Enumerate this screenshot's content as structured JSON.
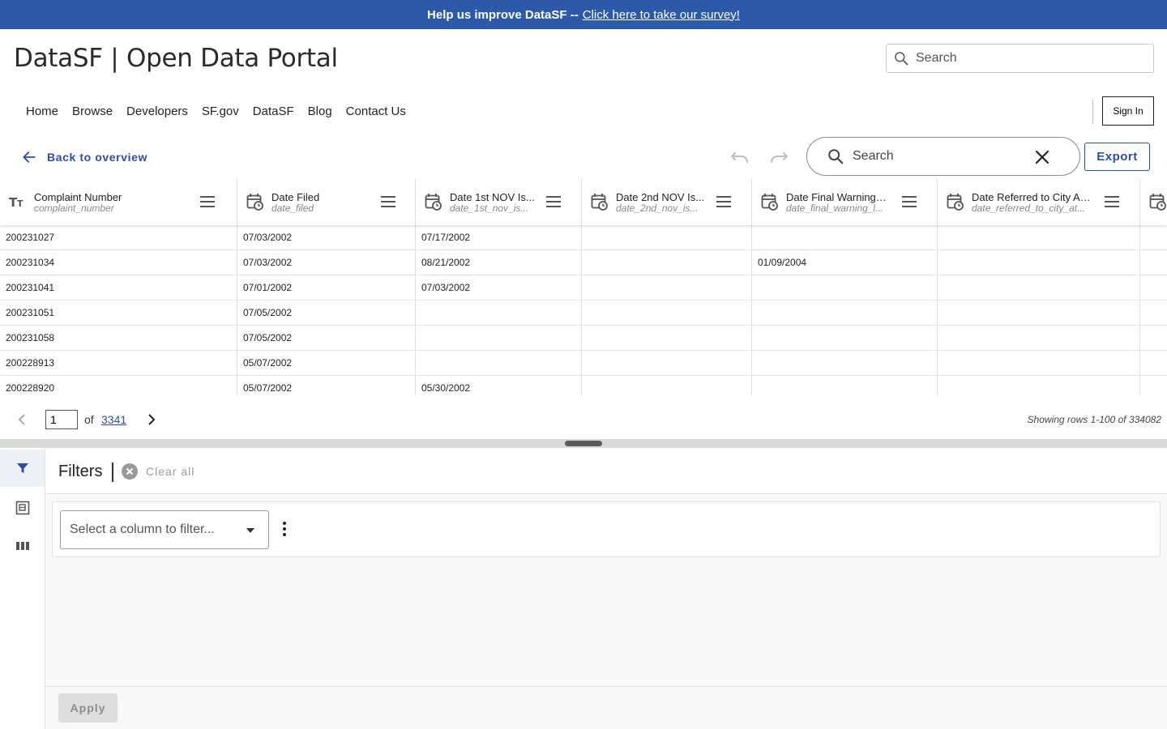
{
  "banner": {
    "text": "Help us improve DataSF --",
    "link_text": "Click here to take our survey!",
    "bg_color": "#2c5aa8"
  },
  "site": {
    "title": "DataSF | Open Data Portal",
    "search_placeholder": "Search"
  },
  "nav": {
    "items": [
      "Home",
      "Browse",
      "Developers",
      "SF.gov",
      "DataSF",
      "Blog",
      "Contact Us"
    ],
    "sign_in": "Sign In"
  },
  "toolbar": {
    "back_label": "Back to overview",
    "search_placeholder": "Search",
    "export_label": "Export",
    "accent_color": "#2c4fa3"
  },
  "grid": {
    "columns": [
      {
        "name": "Complaint Number",
        "field": "complaint_number",
        "type_icon": "text-type-icon"
      },
      {
        "name": "Date Filed",
        "field": "date_filed",
        "type_icon": "calendar-date-icon"
      },
      {
        "name": "Date 1st NOV Is...",
        "field": "date_1st_nov_is...",
        "type_icon": "calendar-date-icon"
      },
      {
        "name": "Date 2nd NOV Is...",
        "field": "date_2nd_nov_is...",
        "type_icon": "calendar-date-icon"
      },
      {
        "name": "Date Final Warning ...",
        "field": "date_final_warning_l...",
        "type_icon": "calendar-date-icon"
      },
      {
        "name": "Date Referred to City Att...",
        "field": "date_referred_to_city_at...",
        "type_icon": "calendar-date-icon"
      }
    ],
    "rows": [
      [
        "200231027",
        "07/03/2002",
        "07/17/2002",
        "",
        "",
        ""
      ],
      [
        "200231034",
        "07/03/2002",
        "08/21/2002",
        "",
        "01/09/2004",
        ""
      ],
      [
        "200231041",
        "07/01/2002",
        "07/03/2002",
        "",
        "",
        ""
      ],
      [
        "200231051",
        "07/05/2002",
        "",
        "",
        "",
        ""
      ],
      [
        "200231058",
        "07/05/2002",
        "",
        "",
        "",
        ""
      ],
      [
        "200228913",
        "05/07/2002",
        "",
        "",
        "",
        ""
      ],
      [
        "200228920",
        "05/07/2002",
        "05/30/2002",
        "",
        "",
        ""
      ]
    ]
  },
  "pager": {
    "current_page": "1",
    "of_label": "of",
    "total_pages": "3341",
    "rows_info": "Showing rows 1-100 of 334082"
  },
  "filters": {
    "title": "Filters",
    "clear_all": "Clear all",
    "column_select_placeholder": "Select a column to filter...",
    "apply_label": "Apply"
  },
  "rail": {
    "items": [
      "filter-icon",
      "table-columns-icon",
      "columns-icon"
    ]
  }
}
